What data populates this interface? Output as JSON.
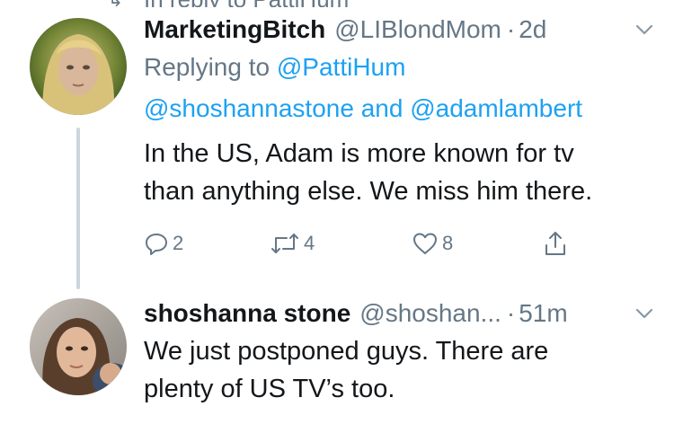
{
  "previous_context": {
    "text": "In reply to PattiHum"
  },
  "tweet1": {
    "display_name": "MarketingBitch",
    "handle": "@LIBlondMom",
    "separator": "·",
    "time": "2d",
    "replying_prefix": "Replying to",
    "replying_to": "@PattiHum",
    "mention_1": "@shoshannastone",
    "mention_and": "and",
    "mention_2": "@adamlambert",
    "text_line1": "In the US, Adam is more known for tv",
    "text_line2": "than anything else. We miss him there.",
    "replies": "2",
    "retweets": "4",
    "likes": "8"
  },
  "tweet2": {
    "display_name": "shoshanna stone",
    "handle": "@shoshan...",
    "separator": "·",
    "time": "51m",
    "text_line1": "We just postponed guys. There are",
    "text_line2": "plenty of US TV’s too."
  },
  "icons": {
    "reply": "reply-icon",
    "retweet": "retweet-icon",
    "like": "heart-icon",
    "share": "share-icon",
    "caret": "chevron-down-icon"
  },
  "colors": {
    "link": "#1da1f2",
    "muted": "#657786",
    "text": "#14171a",
    "thread_line": "#ccd6dd"
  }
}
